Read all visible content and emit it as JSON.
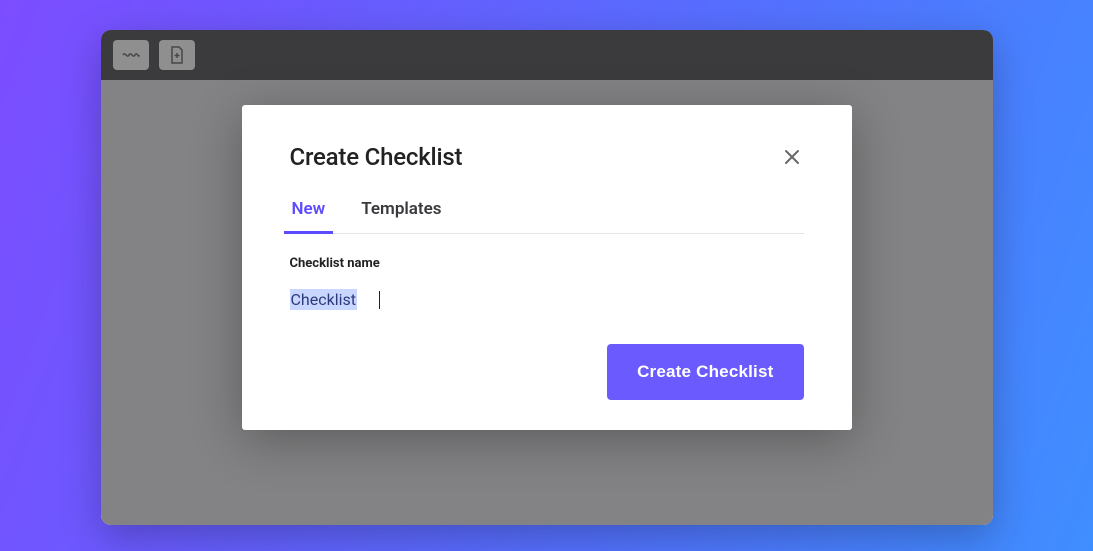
{
  "modal": {
    "title": "Create Checklist",
    "tabs": {
      "new": "New",
      "templates": "Templates",
      "active": "new"
    },
    "field_label": "Checklist name",
    "input_value": "Checklist",
    "submit_label": "Create Checklist"
  },
  "colors": {
    "accent": "#6b5bff"
  }
}
